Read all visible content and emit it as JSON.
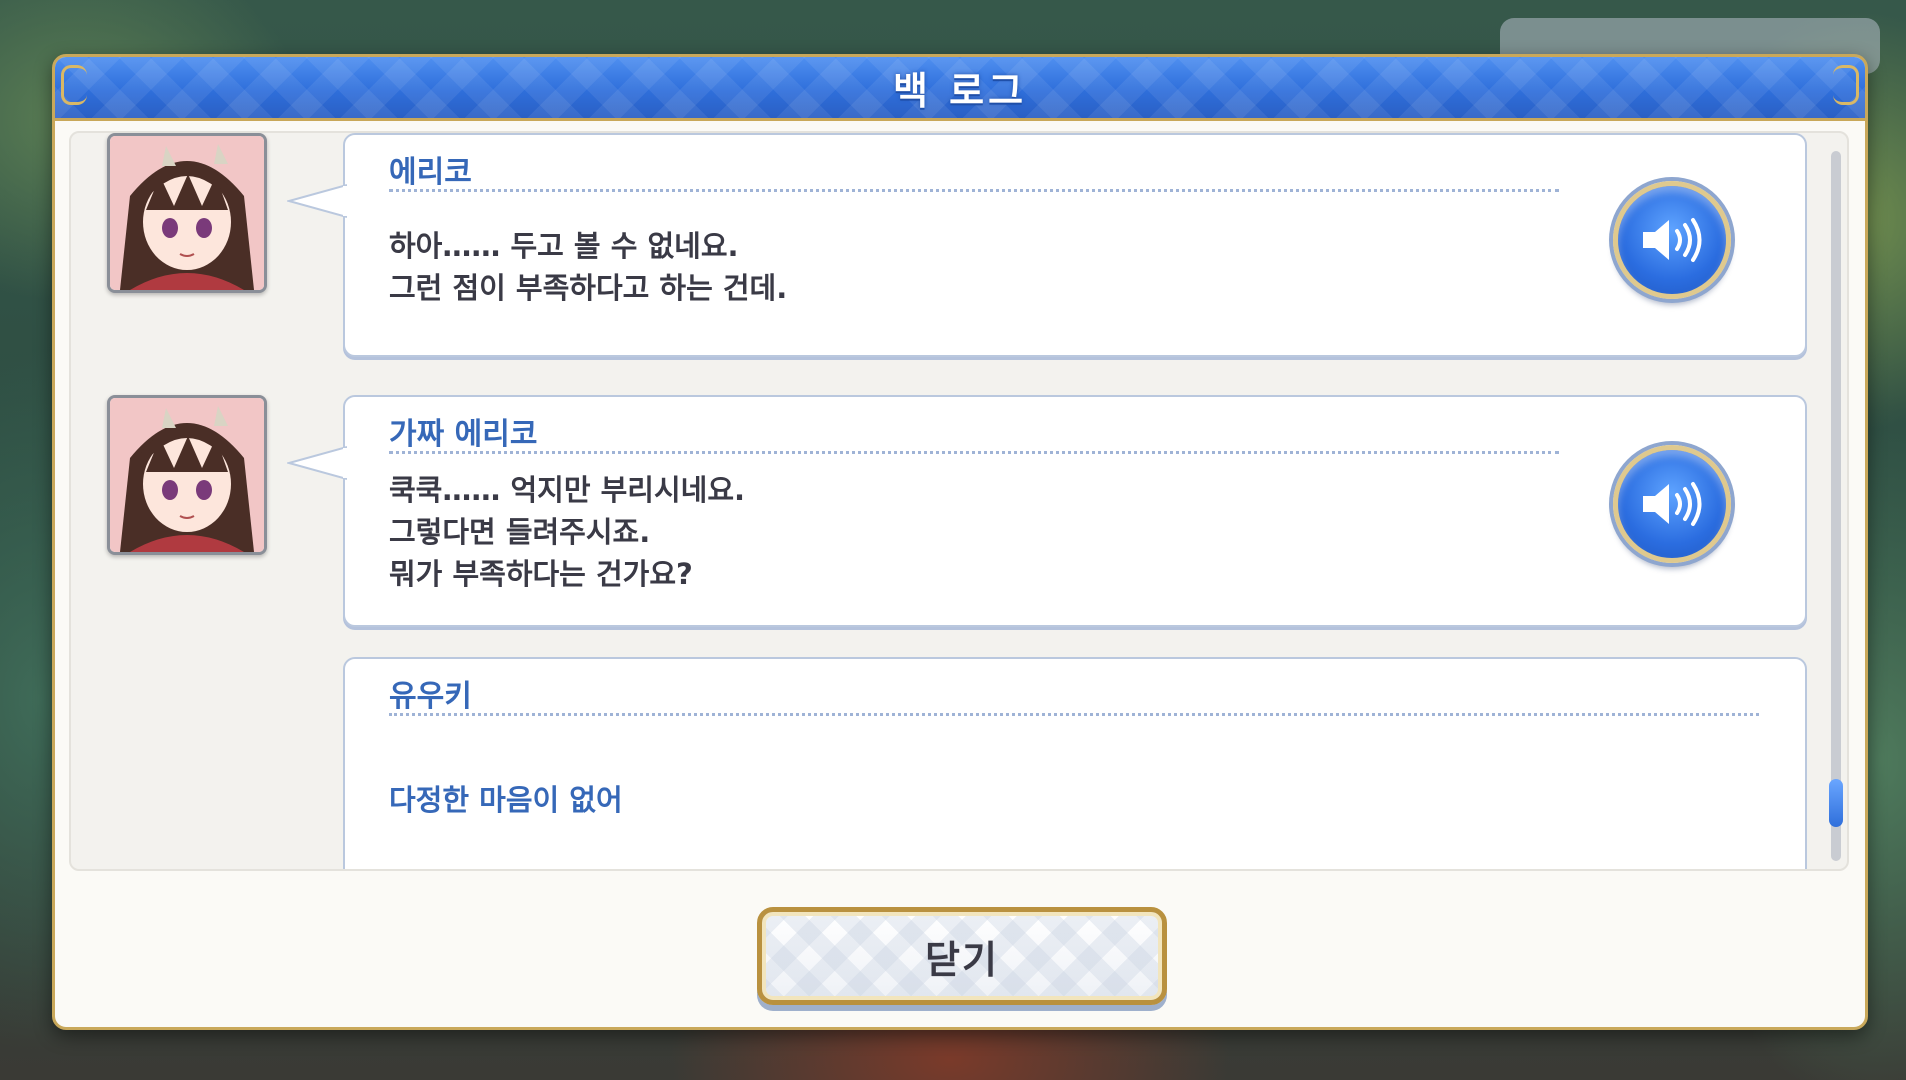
{
  "dialog": {
    "title": "백 로그",
    "close_label": "닫기"
  },
  "entries": [
    {
      "speaker": "에리코",
      "lines": [
        "하아…… 두고 볼 수 없네요.",
        "그런 점이 부족하다고 하는 건데."
      ],
      "has_portrait": true,
      "has_voice": true
    },
    {
      "speaker": "가짜 에리코",
      "lines": [
        "쿡쿡…… 억지만 부리시네요.",
        "그렇다면 들려주시죠.",
        "뭐가 부족하다는 건가요?"
      ],
      "has_portrait": true,
      "has_voice": true
    },
    {
      "speaker": "유우키",
      "lines": [
        "다정한 마음이 없어"
      ],
      "has_portrait": false,
      "has_voice": false,
      "is_choice": true
    }
  ],
  "colors": {
    "header_blue": "#2f6fdb",
    "gold_border": "#c9a85a",
    "speaker_blue": "#3668b8",
    "text_dark": "#3a3a46"
  },
  "icons": {
    "voice": "speaker-volume-icon"
  },
  "scroll": {
    "position_fraction": 0.95
  }
}
